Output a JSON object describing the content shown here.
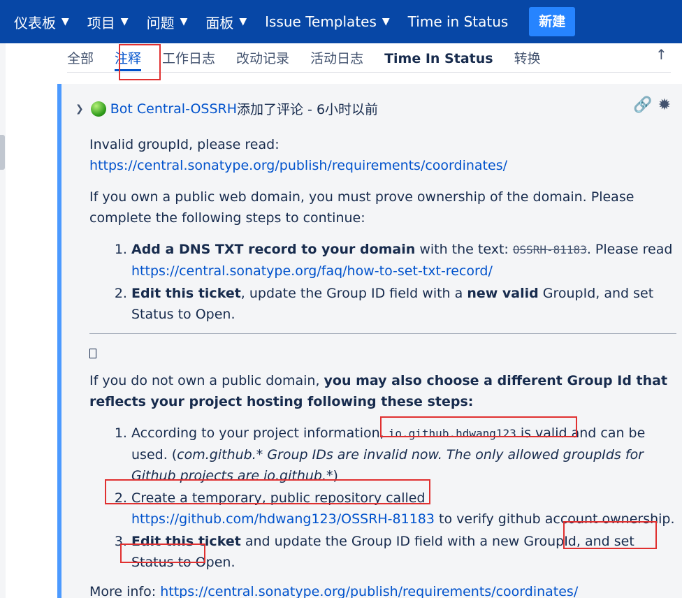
{
  "nav": {
    "items": [
      {
        "label": "仪表板",
        "dropdown": true
      },
      {
        "label": "项目",
        "dropdown": true
      },
      {
        "label": "问题",
        "dropdown": true
      },
      {
        "label": "面板",
        "dropdown": true
      },
      {
        "label": "Issue Templates",
        "dropdown": true
      },
      {
        "label": "Time in Status",
        "dropdown": false
      }
    ],
    "create_label": "新建"
  },
  "tabs": [
    {
      "label": "全部"
    },
    {
      "label": "注释",
      "active": true
    },
    {
      "label": "工作日志"
    },
    {
      "label": "改动记录"
    },
    {
      "label": "活动日志"
    },
    {
      "label": "Time In Status"
    },
    {
      "label": "转换"
    }
  ],
  "comment": {
    "author": "Bot Central-OSSRH",
    "action": " 添加了评论 - 6小时以前",
    "line1": "Invalid groupId, please read:",
    "link1": "https://central.sonatype.org/publish/requirements/coordinates/",
    "para2": "If you own a public web domain, you must prove ownership of the domain. Please complete the following steps to continue:",
    "list1": {
      "item1_bold": "Add a DNS TXT record to your domain",
      "item1_text": " with the text: ",
      "item1_code": "OSSRH-81183",
      "item1_after": ". Please read ",
      "item1_link": "https://central.sonatype.org/faq/how-to-set-txt-record/",
      "item2_bold": "Edit this ticket",
      "item2_text": ", update the Group ID field with a ",
      "item2_bold2": "new valid",
      "item2_after": " GroupId, and set Status to Open."
    },
    "para3_text": "If you do not own a public domain, ",
    "para3_bold": "you may also choose a different Group Id that reflects your project hosting following these steps:",
    "list2": {
      "item1_text": "According to your project information, ",
      "item1_code": "io.github.hdwang123",
      "item1_valid": " is valid",
      "item1_after": " and can be used. (",
      "item1_italic": "com.github.* Group IDs are invalid now. The only allowed groupIds for Github projects are io.github.*",
      "item1_close": ")",
      "item2_text": "Create a temporary, public repository called ",
      "item2_link": "https://github.com/hdwang123/OSSRH-81183",
      "item2_after": " to verify github account ownership.",
      "item3_bold": "Edit this ticket",
      "item3_text": " and update the Group ID field with a new GroupId, ",
      "item3_after": "and set Status to Open."
    },
    "more_label": "More info: ",
    "more_link": "https://central.sonatype.org/publish/requirements/coordinates/"
  }
}
